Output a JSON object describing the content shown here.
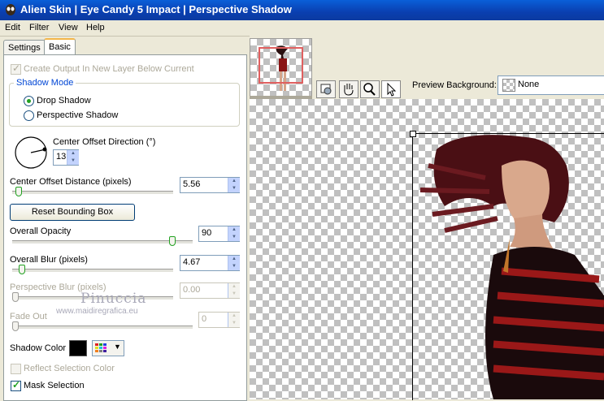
{
  "window": {
    "title": "Alien Skin  |  Eye Candy 5 Impact  |  Perspective Shadow"
  },
  "menu": [
    "Edit",
    "Filter",
    "View",
    "Help"
  ],
  "tabs": [
    {
      "label": "Settings"
    },
    {
      "label": "Basic"
    }
  ],
  "basic": {
    "create_output_label": "Create Output In New Layer Below Current",
    "shadow_mode": {
      "title": "Shadow Mode",
      "options": [
        "Drop Shadow",
        "Perspective Shadow"
      ],
      "selected": "Drop Shadow"
    },
    "center_offset_direction": {
      "label": "Center Offset Direction (°)",
      "value": "13"
    },
    "center_offset_distance": {
      "label": "Center Offset Distance (pixels)",
      "value": "5.56",
      "fraction": 0.02
    },
    "reset_button": "Reset Bounding Box",
    "overall_opacity": {
      "label": "Overall Opacity",
      "value": "90",
      "fraction": 0.9
    },
    "overall_blur": {
      "label": "Overall Blur (pixels)",
      "value": "4.67",
      "fraction": 0.04
    },
    "perspective_blur": {
      "label": "Perspective Blur (pixels)",
      "value": "0.00",
      "fraction": 0.0
    },
    "fade_out": {
      "label": "Fade Out",
      "value": "0",
      "fraction": 0.0
    },
    "shadow_color": {
      "label": "Shadow Color",
      "color": "#000000"
    },
    "reflect_selection_color": {
      "label": "Reflect Selection Color"
    },
    "mask_selection": {
      "label": "Mask Selection"
    }
  },
  "watermark": {
    "line1": "Pinuccia",
    "line2": "www.maidiregrafica.eu"
  },
  "preview": {
    "background_label": "Preview Background:",
    "background_value": "None"
  },
  "icons": [
    "alien-skin-logo-icon",
    "hand-tool-icon",
    "zoom-tool-icon",
    "select-arrow-icon",
    "navigator-icon"
  ]
}
